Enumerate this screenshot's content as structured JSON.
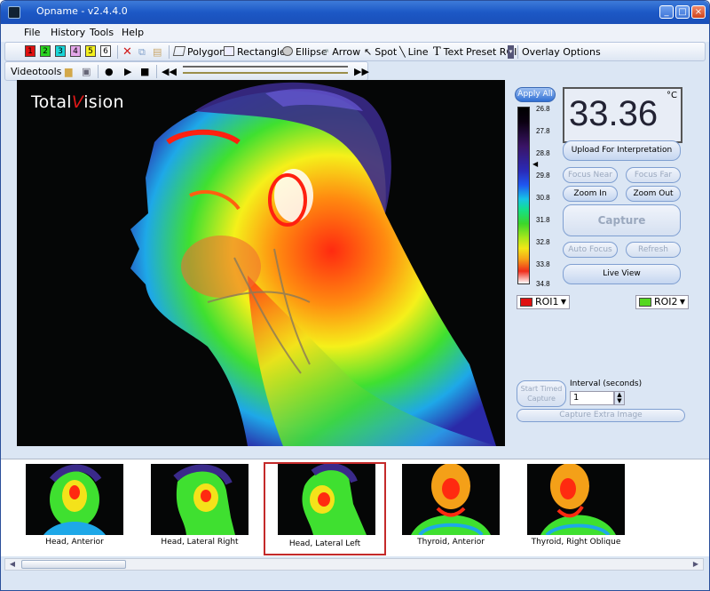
{
  "window": {
    "title": "Opname - v2.4.4.0"
  },
  "menu": [
    "File",
    "History",
    "Tools",
    "Help"
  ],
  "toolbar1": {
    "roi_numbers": [
      "1",
      "2",
      "3",
      "4",
      "5",
      "6"
    ],
    "roi_colors": [
      "#e01010",
      "#2ad31f",
      "#19d5d8",
      "#e3a7e9",
      "#f4f11f",
      "#ffffff"
    ],
    "tools": [
      "Polygon",
      "Rectangle",
      "Ellipse",
      "Arrow",
      "Spot",
      "Line",
      "Text",
      "Preset ROI",
      "Overlay Options"
    ]
  },
  "toolbar2": {
    "label": "Videotools"
  },
  "logo": {
    "part1": "Total",
    "part2": "V",
    "part3": "ision"
  },
  "panel": {
    "apply_all": "Apply All",
    "temperature": "33.36",
    "unit": "°C",
    "ticks": [
      "26.8",
      "27.8",
      "28.8",
      "29.8",
      "30.8",
      "31.8",
      "32.8",
      "33.8",
      "34.8"
    ],
    "upload": "Upload For Interpretation",
    "focus_near": "Focus Near",
    "focus_far": "Focus Far",
    "zoom_in": "Zoom In",
    "zoom_out": "Zoom Out",
    "capture": "Capture",
    "auto_focus": "Auto Focus",
    "refresh": "Refresh",
    "live_view": "Live View",
    "roi1": "ROI1",
    "roi2": "ROI2",
    "start_timed_1": "Start Timed",
    "start_timed_2": "Capture",
    "interval_label": "Interval (seconds)",
    "interval_value": "1",
    "capture_extra": "Capture Extra Image"
  },
  "thumbnails": [
    {
      "label": "Head, Anterior",
      "selected": false
    },
    {
      "label": "Head, Lateral Right",
      "selected": false
    },
    {
      "label": "Head, Lateral Left",
      "selected": true
    },
    {
      "label": "Thyroid, Anterior",
      "selected": false
    },
    {
      "label": "Thyroid, Right Oblique",
      "selected": false
    }
  ]
}
